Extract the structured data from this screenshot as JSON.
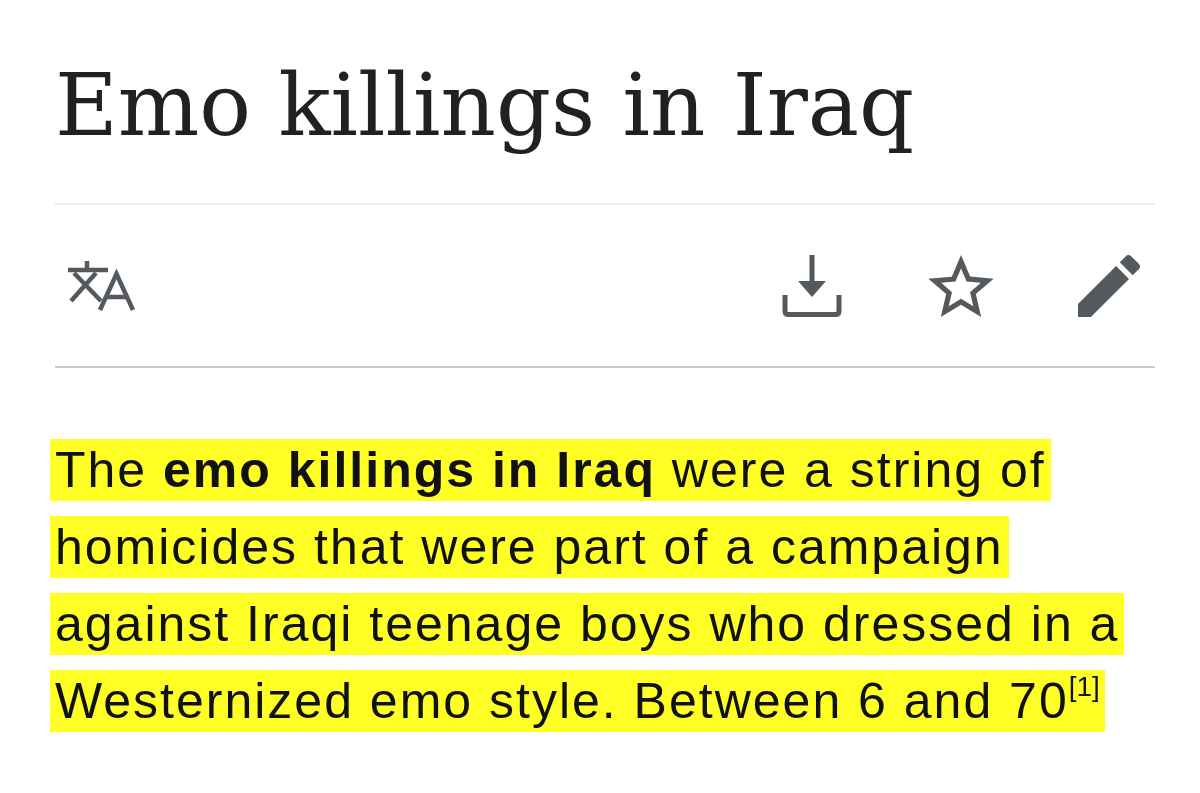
{
  "article": {
    "title": "Emo killings in Iraq",
    "toolbar": {
      "starred": false
    },
    "lead": {
      "text": "The **emo killings in Iraq** were a string of homicides that were part of a campaign against Iraqi teenage boys who dressed in a Westernized emo style. Between 6 and 70",
      "citation": "[1]",
      "highlighted": true
    }
  }
}
